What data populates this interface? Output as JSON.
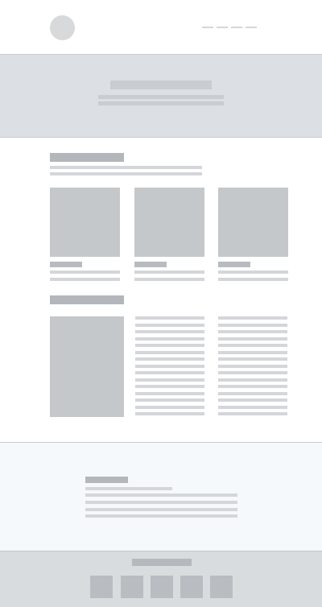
{
  "colors": {
    "page_background": "#ffffff",
    "placeholder_light": "#d4d6d9",
    "placeholder_mid": "#c5c8cb",
    "placeholder_dark": "#b3b6ba",
    "hero_background": "#dcdfe3",
    "light_section_background": "#f6f9fc",
    "footer_background": "#d9dcdf"
  },
  "icons": {
    "logo": "circle-logo-placeholder",
    "social": [
      "social-icon-1",
      "social-icon-2",
      "social-icon-3",
      "social-icon-4",
      "social-icon-5"
    ]
  },
  "structure": {
    "header": {
      "nav_items": 4
    },
    "features": {
      "cards": 3
    },
    "media_with_text_columns": 2,
    "footer": {
      "social_icons": 5
    }
  }
}
